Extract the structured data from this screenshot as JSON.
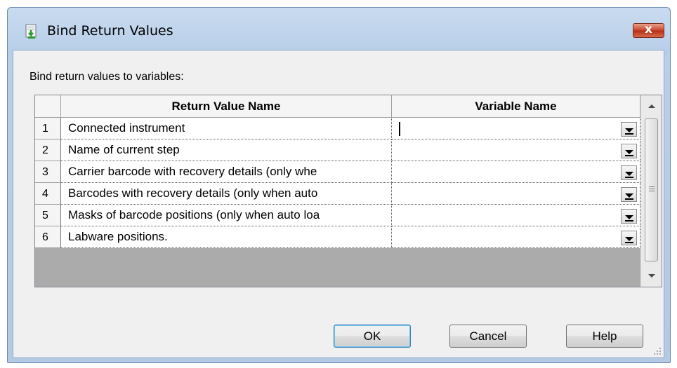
{
  "window": {
    "title": "Bind Return Values",
    "close_label": "x"
  },
  "prompt": "Bind return values to variables:",
  "table": {
    "headers": [
      "Return Value Name",
      "Variable Name"
    ],
    "rows": [
      {
        "num": "1",
        "name": "Connected instrument",
        "variable": ""
      },
      {
        "num": "2",
        "name": "Name of current step",
        "variable": ""
      },
      {
        "num": "3",
        "name": "Carrier barcode with recovery details (only whe",
        "variable": ""
      },
      {
        "num": "4",
        "name": "Barcodes with recovery details (only when auto",
        "variable": ""
      },
      {
        "num": "5",
        "name": "Masks of barcode positions (only when auto loa",
        "variable": ""
      },
      {
        "num": "6",
        "name": "Labware positions.",
        "variable": ""
      }
    ]
  },
  "buttons": {
    "ok": "OK",
    "cancel": "Cancel",
    "help": "Help"
  }
}
